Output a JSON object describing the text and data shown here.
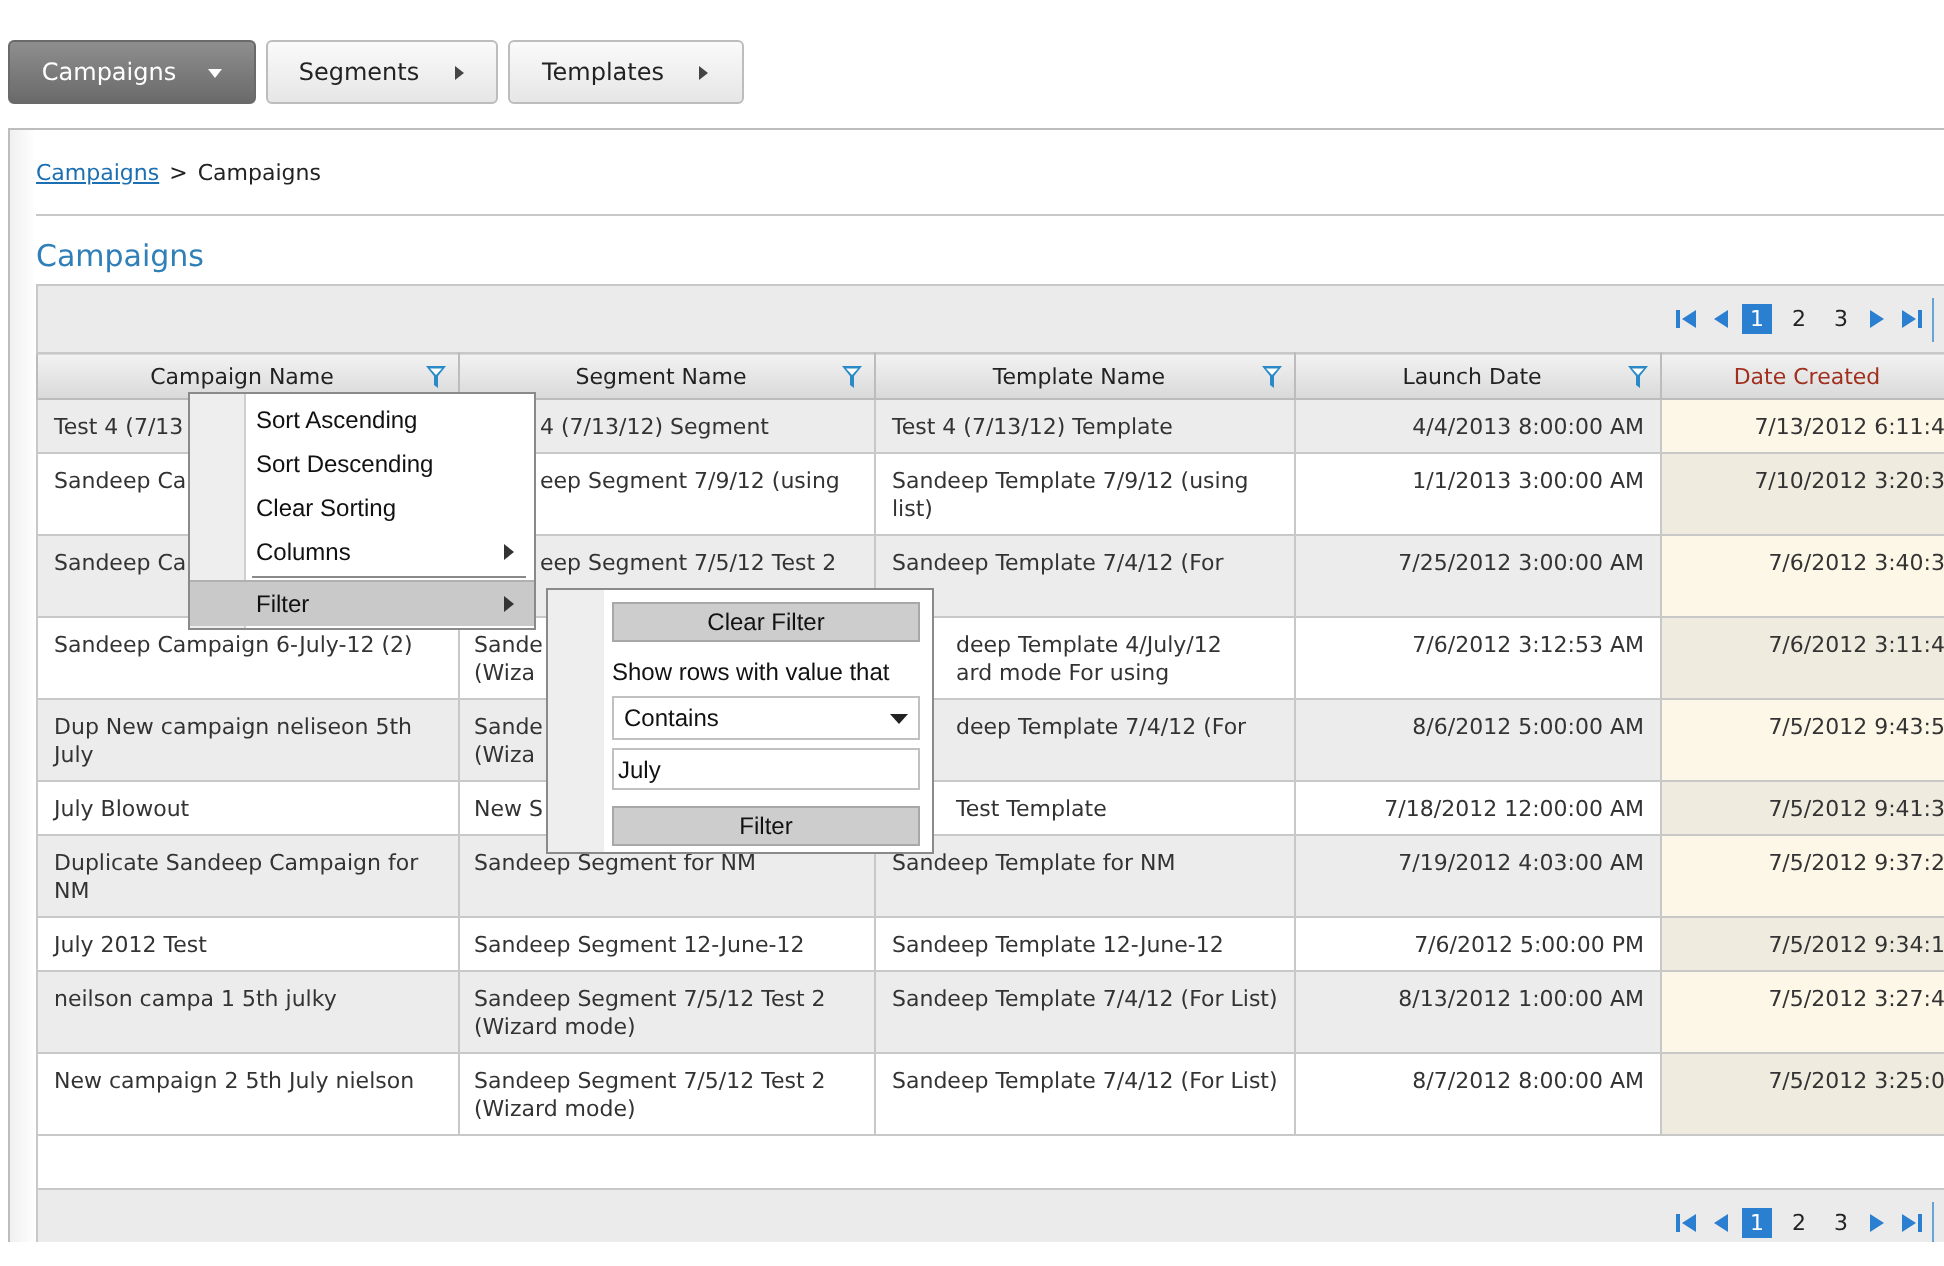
{
  "tabs": [
    {
      "label": "Campaigns",
      "selected": true
    },
    {
      "label": "Segments",
      "selected": false
    },
    {
      "label": "Templates",
      "selected": false
    }
  ],
  "breadcrumb": {
    "link": "Campaigns",
    "separator": ">",
    "current": "Campaigns"
  },
  "title": "Campaigns",
  "grid": {
    "pager_top": {
      "pages": [
        {
          "label": "1",
          "selected": true
        },
        {
          "label": "2",
          "selected": false
        },
        {
          "label": "3",
          "selected": false
        }
      ]
    },
    "columns": [
      {
        "label": "Campaign Name",
        "filter": true,
        "sorted": false
      },
      {
        "label": "Segment Name",
        "filter": true,
        "sorted": false
      },
      {
        "label": "Template Name",
        "filter": true,
        "sorted": false
      },
      {
        "label": "Launch Date",
        "filter": true,
        "sorted": false
      },
      {
        "label": "Date Created",
        "filter": false,
        "sorted": true
      }
    ],
    "rows": [
      {
        "cells": [
          "Test 4 (7/13",
          {
            "text": "4 (7/13/12) Segment",
            "covered_left": true
          },
          "Test 4 (7/13/12) Template",
          "4/4/2013 8:00:00 AM",
          "7/13/2012 6:11:4"
        ]
      },
      {
        "cells": [
          "Sandeep Ca",
          {
            "text": "eep Segment 7/9/12 (using",
            "covered_left": true
          },
          "Sandeep Template 7/9/12 (using list)",
          "1/1/2013 3:00:00 AM",
          "7/10/2012 3:20:3"
        ]
      },
      {
        "cells": [
          "Sandeep Ca",
          {
            "text": "eep Segment 7/5/12 Test 2",
            "covered_left": true,
            "covered_below": true
          },
          "Sandeep Template 7/4/12 (For",
          "7/25/2012 3:00:00 AM",
          "7/6/2012 3:40:3"
        ]
      },
      {
        "cells": [
          "Sandeep Campaign 6-July-12 (2)",
          "Sande\n(Wiza",
          {
            "text": "deep Template 4/July/12\nard mode For using",
            "covered_left": true
          },
          "7/6/2012 3:12:53 AM",
          "7/6/2012 3:11:4"
        ]
      },
      {
        "cells": [
          "Dup New campaign neliseon 5th July",
          "Sande\n(Wiza",
          {
            "text": "deep Template 7/4/12 (For",
            "covered_left": true
          },
          "8/6/2012 5:00:00 AM",
          "7/5/2012 9:43:5"
        ]
      },
      {
        "cells": [
          "July Blowout",
          "New S",
          {
            "text": "Test Template",
            "covered_left": true
          },
          "7/18/2012 12:00:00 AM",
          "7/5/2012 9:41:3"
        ]
      },
      {
        "cells": [
          "Duplicate Sandeep Campaign for NM",
          "Sandeep Segment for NM",
          "Sandeep Template for NM",
          "7/19/2012 4:03:00 AM",
          "7/5/2012 9:37:2"
        ]
      },
      {
        "cells": [
          "July 2012 Test",
          "Sandeep Segment 12-June-12",
          "Sandeep Template 12-June-12",
          "7/6/2012 5:00:00 PM",
          "7/5/2012 9:34:1"
        ]
      },
      {
        "cells": [
          "neilson campa 1 5th julky",
          "Sandeep Segment 7/5/12 Test 2 (Wizard mode)",
          "Sandeep Template 7/4/12 (For List)",
          "8/13/2012 1:00:00 AM",
          "7/5/2012 3:27:4"
        ]
      },
      {
        "cells": [
          "New campaign 2 5th July nielson",
          "Sandeep Segment 7/5/12 Test 2 (Wizard mode)",
          "Sandeep Template 7/4/12 (For List)",
          "8/7/2012 8:00:00 AM",
          "7/5/2012 3:25:0"
        ]
      }
    ],
    "pager_bottom": {
      "pages": [
        {
          "label": "1",
          "selected": true
        },
        {
          "label": "2",
          "selected": false
        },
        {
          "label": "3",
          "selected": false
        }
      ]
    }
  },
  "column_menu": {
    "items": [
      {
        "label": "Sort Ascending",
        "submenu": false,
        "highlighted": false
      },
      {
        "label": "Sort Descending",
        "submenu": false,
        "highlighted": false
      },
      {
        "label": "Clear Sorting",
        "submenu": false,
        "highlighted": false
      },
      {
        "label": "Columns",
        "submenu": true,
        "highlighted": false
      },
      {
        "label": "Filter",
        "submenu": true,
        "highlighted": true
      }
    ]
  },
  "filter_panel": {
    "clear_button": "Clear Filter",
    "label": "Show rows with value that",
    "operator": "Contains",
    "value": "July",
    "filter_button": "Filter"
  }
}
